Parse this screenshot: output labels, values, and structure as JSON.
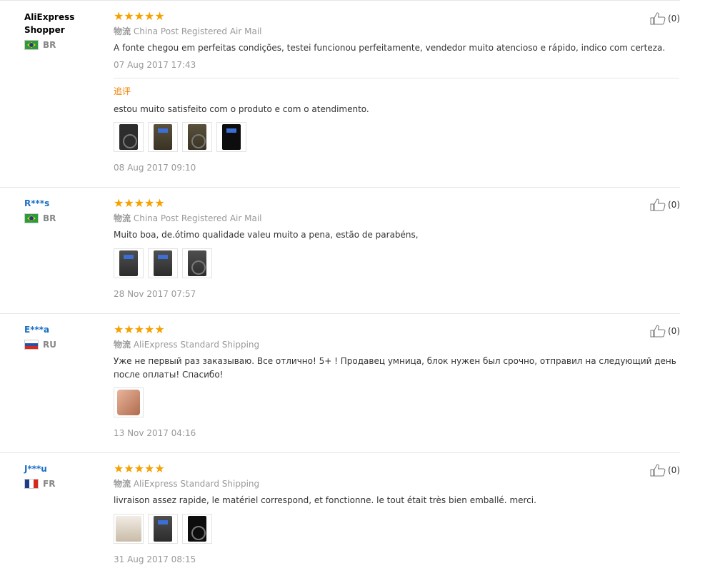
{
  "reviews": [
    {
      "user": "AliExpress Shopper",
      "country": "BR",
      "stars": "★★★★★",
      "shipping_cn": "物流",
      "shipping": "China Post Registered Air Mail",
      "text": "A fonte chegou em perfeitas condições, testei funcionou perfeitamente, vendedor muito atencioso e rápido, indico com certeza.",
      "date": "07 Aug 2017 17:43",
      "likes": "(0)",
      "followup": {
        "label": "追评",
        "text": "estou muito satisfeito com o produto e com o atendimento.",
        "date": "08 Aug 2017 09:10"
      }
    },
    {
      "user": "R***s",
      "country": "BR",
      "stars": "★★★★★",
      "shipping_cn": "物流",
      "shipping": "China Post Registered Air Mail",
      "text": "Muito boa, de.ótimo qualidade valeu muito a pena, estão de parabéns,",
      "date": "28 Nov 2017 07:57",
      "likes": "(0)"
    },
    {
      "user": "E***a",
      "country": "RU",
      "stars": "★★★★★",
      "shipping_cn": "物流",
      "shipping": "AliExpress Standard Shipping",
      "text": "Уже не первый раз заказываю. Все отлично! 5+ ! Продавец умница, блок нужен был срочно, отправил на следующий день после оплаты! Спасибо!",
      "date": "13 Nov 2017 04:16",
      "likes": "(0)"
    },
    {
      "user": "J***u",
      "country": "FR",
      "stars": "★★★★★",
      "shipping_cn": "物流",
      "shipping": "AliExpress Standard Shipping",
      "text": "livraison assez rapide, le matériel correspond, et fonctionne. le tout était très bien emballé. merci.",
      "date": "31 Aug 2017 08:15",
      "likes": "(0)"
    }
  ],
  "icons": {
    "like": "thumbs-up-icon"
  },
  "colors": {
    "star": "#f5a100",
    "link": "#1a6fc4",
    "followup": "#f08000"
  }
}
